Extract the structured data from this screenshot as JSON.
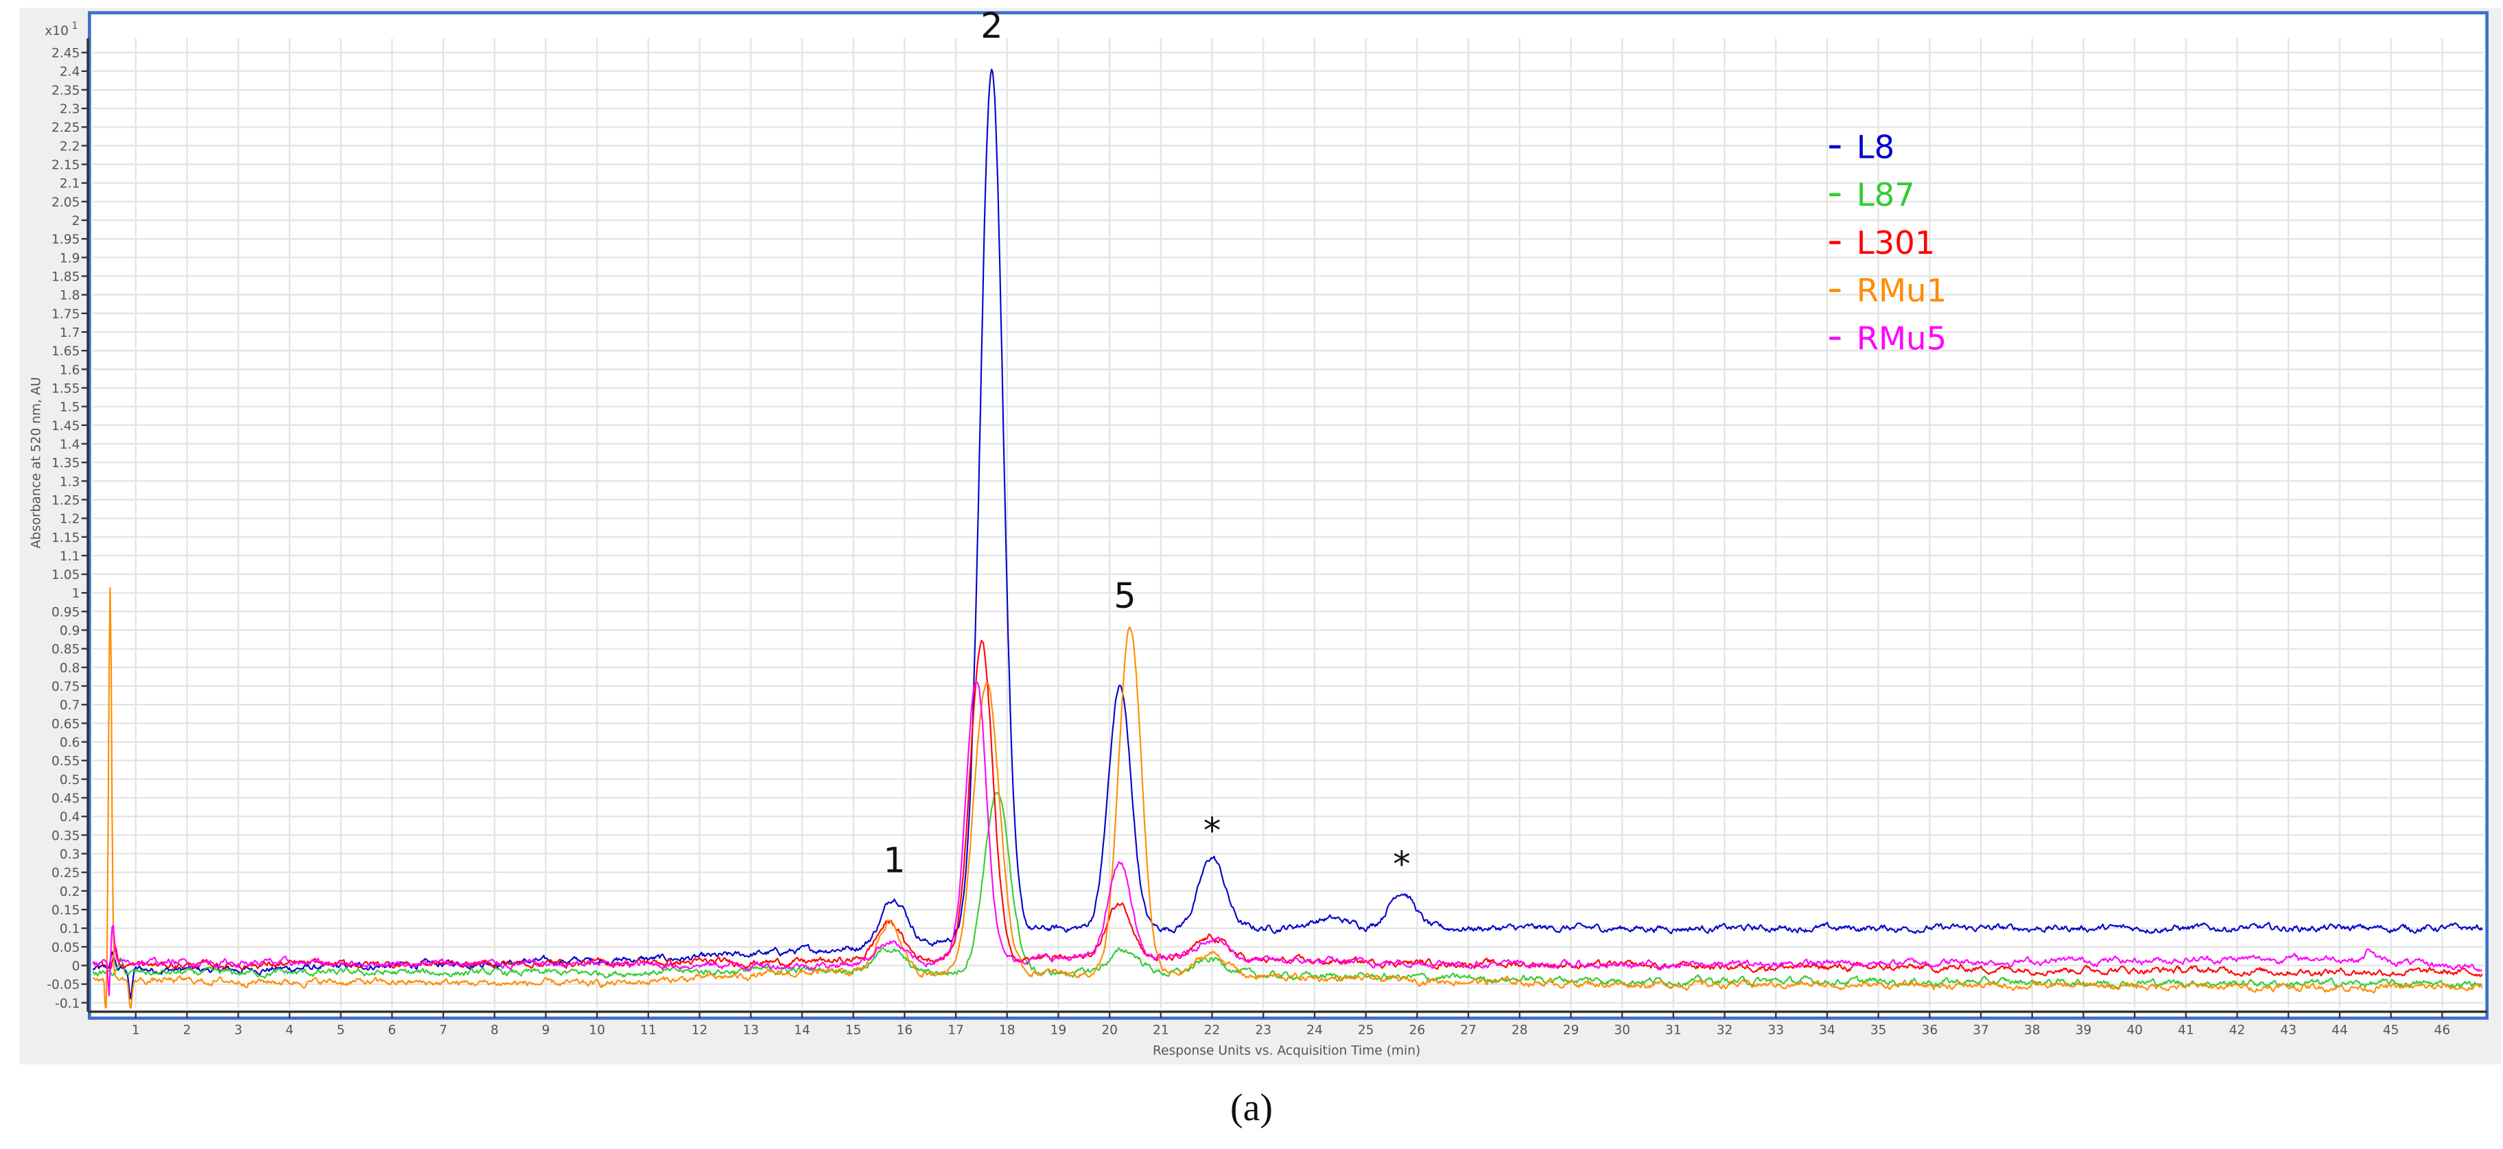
{
  "chart_data": {
    "type": "line",
    "title": "",
    "caption": "(a)",
    "xlabel": "Response Units vs. Acquisition Time (min)",
    "ylabel": "Absorbance at 520 nm, AU",
    "y_multiplier": "x10",
    "y_multiplier_exp": "1",
    "xlim": [
      0.16,
      46.8
    ],
    "ylim": [
      -0.115,
      2.49
    ],
    "x_ticks": {
      "start": 1,
      "end": 46,
      "step": 1
    },
    "y_ticks": {
      "start": -0.1,
      "end": 2.45,
      "step": 0.05
    },
    "grid": true,
    "legend_position": "top-right",
    "series": [
      {
        "name": "L8",
        "color": "#0000cc",
        "baseline": [
          [
            0.16,
            -0.01
          ],
          [
            3,
            -0.012
          ],
          [
            8,
            0.008
          ],
          [
            12,
            0.02
          ],
          [
            14,
            0.04
          ],
          [
            15.3,
            0.05
          ],
          [
            16.6,
            0.06
          ],
          [
            17.2,
            0.08
          ],
          [
            19,
            0.1
          ],
          [
            47,
            0.1
          ]
        ],
        "peaks": [
          [
            0.55,
            0.04,
            0.04
          ],
          [
            0.9,
            -0.08,
            0.03
          ],
          [
            15.8,
            0.13,
            0.25
          ],
          [
            17.7,
            2.33,
            0.22
          ],
          [
            20.2,
            0.65,
            0.22
          ],
          [
            22.0,
            0.19,
            0.25
          ],
          [
            24.3,
            0.025,
            0.4
          ],
          [
            25.7,
            0.1,
            0.25
          ]
        ]
      },
      {
        "name": "L87",
        "color": "#33cc33",
        "baseline": [
          [
            0.16,
            -0.02
          ],
          [
            10,
            -0.02
          ],
          [
            15,
            -0.01
          ],
          [
            17,
            -0.02
          ],
          [
            20,
            -0.02
          ],
          [
            30,
            -0.04
          ],
          [
            47,
            -0.05
          ]
        ],
        "peaks": [
          [
            0.7,
            0.03,
            0.04
          ],
          [
            15.7,
            0.06,
            0.25
          ],
          [
            17.8,
            0.48,
            0.25
          ],
          [
            20.3,
            0.06,
            0.3
          ],
          [
            22.0,
            0.04,
            0.3
          ]
        ]
      },
      {
        "name": "L301",
        "color": "#ff0000",
        "baseline": [
          [
            0.16,
            0
          ],
          [
            14,
            0.01
          ],
          [
            17,
            0.02
          ],
          [
            19,
            0.02
          ],
          [
            30,
            0.0
          ],
          [
            47,
            -0.02
          ]
        ],
        "peaks": [
          [
            0.6,
            0.05,
            0.04
          ],
          [
            15.7,
            0.1,
            0.25
          ],
          [
            17.5,
            0.85,
            0.22
          ],
          [
            20.2,
            0.15,
            0.25
          ],
          [
            22.0,
            0.06,
            0.3
          ]
        ]
      },
      {
        "name": "RMu1",
        "color": "#ff8c00",
        "baseline": [
          [
            0.16,
            -0.03
          ],
          [
            1,
            -0.04
          ],
          [
            10,
            -0.05
          ],
          [
            14,
            -0.02
          ],
          [
            19,
            -0.02
          ],
          [
            30,
            -0.05
          ],
          [
            47,
            -0.06
          ]
        ],
        "peaks": [
          [
            0.5,
            1.05,
            0.03
          ],
          [
            0.42,
            -0.12,
            0.02
          ],
          [
            0.9,
            -0.08,
            0.03
          ],
          [
            15.7,
            0.14,
            0.22
          ],
          [
            17.6,
            0.78,
            0.25
          ],
          [
            20.4,
            0.93,
            0.22
          ],
          [
            22.0,
            0.06,
            0.3
          ]
        ]
      },
      {
        "name": "RMu5",
        "color": "#ff00ff",
        "baseline": [
          [
            0.16,
            0.01
          ],
          [
            14,
            0.0
          ],
          [
            19,
            0.02
          ],
          [
            30,
            0.0
          ],
          [
            44,
            0.02
          ],
          [
            47,
            -0.01
          ]
        ],
        "peaks": [
          [
            0.55,
            0.09,
            0.03
          ],
          [
            0.48,
            -0.1,
            0.02
          ],
          [
            15.7,
            0.06,
            0.25
          ],
          [
            17.4,
            0.76,
            0.2
          ],
          [
            20.2,
            0.26,
            0.22
          ],
          [
            22.0,
            0.06,
            0.3
          ],
          [
            44.6,
            0.03,
            0.08
          ]
        ]
      }
    ],
    "annotations": [
      {
        "text": "1",
        "x": 15.8,
        "y": 0.25
      },
      {
        "text": "2",
        "x": 17.7,
        "y": 2.49
      },
      {
        "text": "5",
        "x": 20.3,
        "y": 0.96
      },
      {
        "text": "*",
        "x": 22.0,
        "y": 0.33
      },
      {
        "text": "*",
        "x": 25.7,
        "y": 0.24
      }
    ]
  }
}
